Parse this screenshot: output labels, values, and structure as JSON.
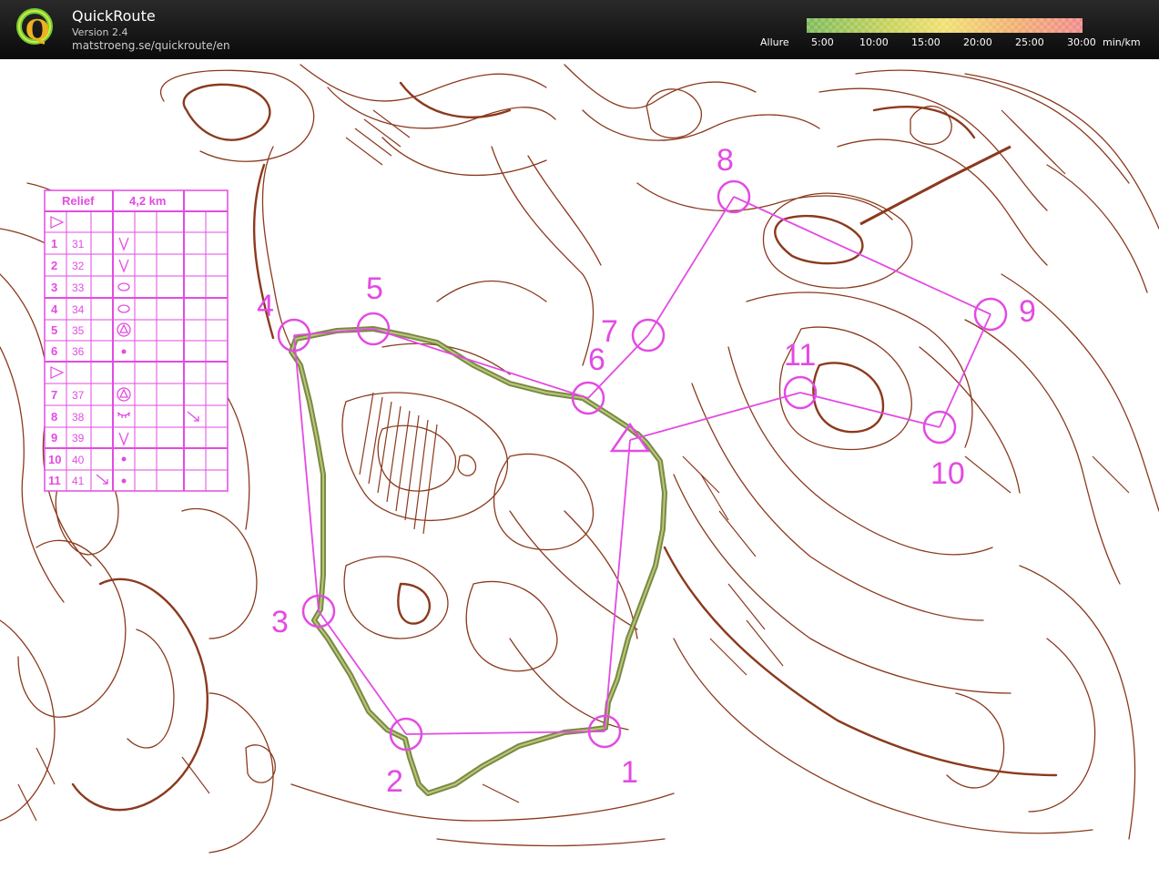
{
  "app": {
    "title": "QuickRoute",
    "version": "Version 2.4",
    "url": "matstroeng.se/quickroute/en"
  },
  "pace_scale": {
    "label": "Allure",
    "ticks": [
      "5:00",
      "10:00",
      "15:00",
      "20:00",
      "25:00",
      "30:00"
    ],
    "unit": "min/km",
    "colors": [
      "#7dbb5a",
      "#c8d25a",
      "#f0e070",
      "#f0b070",
      "#f08a8a"
    ]
  },
  "map": {
    "contour_color": "#8b3a1e",
    "course_color": "#e34be3",
    "route_color": "#7a8f3a"
  },
  "course": {
    "title": "Relief",
    "length": "4,2 km",
    "controls": [
      {
        "num": "1",
        "code": "31",
        "symbol": "V"
      },
      {
        "num": "2",
        "code": "32",
        "symbol": "V"
      },
      {
        "num": "3",
        "code": "33",
        "symbol": "0"
      },
      {
        "num": "4",
        "code": "34",
        "symbol": "0"
      },
      {
        "num": "5",
        "code": "35",
        "symbol": "triangle-circle"
      },
      {
        "num": "6",
        "code": "36",
        "symbol": "dot"
      },
      {
        "num": "7",
        "code": "37",
        "symbol": "triangle-circle"
      },
      {
        "num": "8",
        "code": "38",
        "symbol": "comb"
      },
      {
        "num": "9",
        "code": "39",
        "symbol": "V"
      },
      {
        "num": "10",
        "code": "40",
        "symbol": "dot"
      },
      {
        "num": "11",
        "code": "41",
        "symbol": "dot"
      }
    ],
    "map_labels": [
      "1",
      "2",
      "3",
      "4",
      "5",
      "6",
      "7",
      "8",
      "9",
      "10",
      "11"
    ]
  }
}
